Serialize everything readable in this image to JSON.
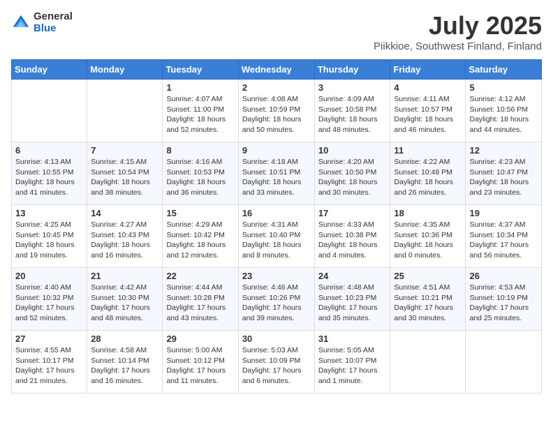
{
  "logo": {
    "general": "General",
    "blue": "Blue"
  },
  "title": {
    "month": "July 2025",
    "location": "Piikkioe, Southwest Finland, Finland"
  },
  "days_of_week": [
    "Sunday",
    "Monday",
    "Tuesday",
    "Wednesday",
    "Thursday",
    "Friday",
    "Saturday"
  ],
  "weeks": [
    [
      {
        "day": "",
        "info": ""
      },
      {
        "day": "",
        "info": ""
      },
      {
        "day": "1",
        "info": "Sunrise: 4:07 AM\nSunset: 11:00 PM\nDaylight: 18 hours and 52 minutes."
      },
      {
        "day": "2",
        "info": "Sunrise: 4:08 AM\nSunset: 10:59 PM\nDaylight: 18 hours and 50 minutes."
      },
      {
        "day": "3",
        "info": "Sunrise: 4:09 AM\nSunset: 10:58 PM\nDaylight: 18 hours and 48 minutes."
      },
      {
        "day": "4",
        "info": "Sunrise: 4:11 AM\nSunset: 10:57 PM\nDaylight: 18 hours and 46 minutes."
      },
      {
        "day": "5",
        "info": "Sunrise: 4:12 AM\nSunset: 10:56 PM\nDaylight: 18 hours and 44 minutes."
      }
    ],
    [
      {
        "day": "6",
        "info": "Sunrise: 4:13 AM\nSunset: 10:55 PM\nDaylight: 18 hours and 41 minutes."
      },
      {
        "day": "7",
        "info": "Sunrise: 4:15 AM\nSunset: 10:54 PM\nDaylight: 18 hours and 38 minutes."
      },
      {
        "day": "8",
        "info": "Sunrise: 4:16 AM\nSunset: 10:53 PM\nDaylight: 18 hours and 36 minutes."
      },
      {
        "day": "9",
        "info": "Sunrise: 4:18 AM\nSunset: 10:51 PM\nDaylight: 18 hours and 33 minutes."
      },
      {
        "day": "10",
        "info": "Sunrise: 4:20 AM\nSunset: 10:50 PM\nDaylight: 18 hours and 30 minutes."
      },
      {
        "day": "11",
        "info": "Sunrise: 4:22 AM\nSunset: 10:48 PM\nDaylight: 18 hours and 26 minutes."
      },
      {
        "day": "12",
        "info": "Sunrise: 4:23 AM\nSunset: 10:47 PM\nDaylight: 18 hours and 23 minutes."
      }
    ],
    [
      {
        "day": "13",
        "info": "Sunrise: 4:25 AM\nSunset: 10:45 PM\nDaylight: 18 hours and 19 minutes."
      },
      {
        "day": "14",
        "info": "Sunrise: 4:27 AM\nSunset: 10:43 PM\nDaylight: 18 hours and 16 minutes."
      },
      {
        "day": "15",
        "info": "Sunrise: 4:29 AM\nSunset: 10:42 PM\nDaylight: 18 hours and 12 minutes."
      },
      {
        "day": "16",
        "info": "Sunrise: 4:31 AM\nSunset: 10:40 PM\nDaylight: 18 hours and 8 minutes."
      },
      {
        "day": "17",
        "info": "Sunrise: 4:33 AM\nSunset: 10:38 PM\nDaylight: 18 hours and 4 minutes."
      },
      {
        "day": "18",
        "info": "Sunrise: 4:35 AM\nSunset: 10:36 PM\nDaylight: 18 hours and 0 minutes."
      },
      {
        "day": "19",
        "info": "Sunrise: 4:37 AM\nSunset: 10:34 PM\nDaylight: 17 hours and 56 minutes."
      }
    ],
    [
      {
        "day": "20",
        "info": "Sunrise: 4:40 AM\nSunset: 10:32 PM\nDaylight: 17 hours and 52 minutes."
      },
      {
        "day": "21",
        "info": "Sunrise: 4:42 AM\nSunset: 10:30 PM\nDaylight: 17 hours and 48 minutes."
      },
      {
        "day": "22",
        "info": "Sunrise: 4:44 AM\nSunset: 10:28 PM\nDaylight: 17 hours and 43 minutes."
      },
      {
        "day": "23",
        "info": "Sunrise: 4:46 AM\nSunset: 10:26 PM\nDaylight: 17 hours and 39 minutes."
      },
      {
        "day": "24",
        "info": "Sunrise: 4:48 AM\nSunset: 10:23 PM\nDaylight: 17 hours and 35 minutes."
      },
      {
        "day": "25",
        "info": "Sunrise: 4:51 AM\nSunset: 10:21 PM\nDaylight: 17 hours and 30 minutes."
      },
      {
        "day": "26",
        "info": "Sunrise: 4:53 AM\nSunset: 10:19 PM\nDaylight: 17 hours and 25 minutes."
      }
    ],
    [
      {
        "day": "27",
        "info": "Sunrise: 4:55 AM\nSunset: 10:17 PM\nDaylight: 17 hours and 21 minutes."
      },
      {
        "day": "28",
        "info": "Sunrise: 4:58 AM\nSunset: 10:14 PM\nDaylight: 17 hours and 16 minutes."
      },
      {
        "day": "29",
        "info": "Sunrise: 5:00 AM\nSunset: 10:12 PM\nDaylight: 17 hours and 11 minutes."
      },
      {
        "day": "30",
        "info": "Sunrise: 5:03 AM\nSunset: 10:09 PM\nDaylight: 17 hours and 6 minutes."
      },
      {
        "day": "31",
        "info": "Sunrise: 5:05 AM\nSunset: 10:07 PM\nDaylight: 17 hours and 1 minute."
      },
      {
        "day": "",
        "info": ""
      },
      {
        "day": "",
        "info": ""
      }
    ]
  ]
}
